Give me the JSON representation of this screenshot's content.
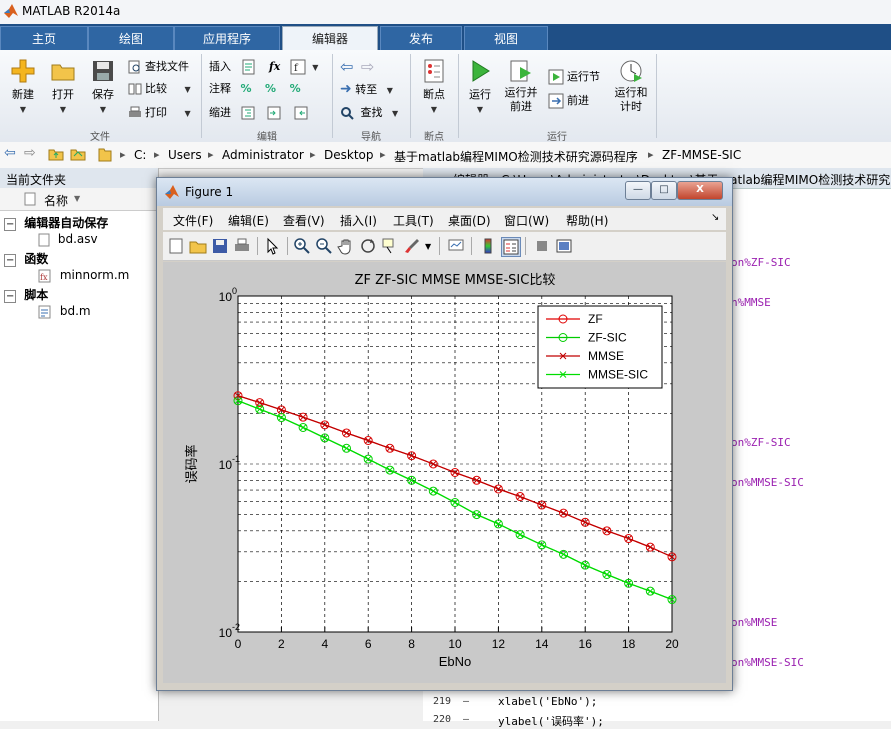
{
  "app": {
    "title": "MATLAB R2014a"
  },
  "tabs": [
    {
      "label": "主页"
    },
    {
      "label": "绘图"
    },
    {
      "label": "应用程序"
    },
    {
      "label": "编辑器",
      "active": true
    },
    {
      "label": "发布"
    },
    {
      "label": "视图"
    }
  ],
  "ribbon": {
    "file": {
      "new": "新建",
      "open": "打开",
      "save": "保存",
      "find_files": "查找文件",
      "compare": "比较",
      "print": "打印",
      "group": "文件"
    },
    "edit": {
      "insert": "插入",
      "comment": "注释",
      "indent": "缩进",
      "fx": "fx",
      "group": "编辑"
    },
    "nav": {
      "goto": "转至",
      "find": "查找",
      "group": "导航"
    },
    "breakpoints": {
      "label": "断点",
      "group": "断点"
    },
    "run": {
      "run": "运行",
      "run_advance": "运行并\n前进",
      "run_section": "运行节",
      "advance": "前进",
      "run_time": "运行和\n计时",
      "group": "运行"
    }
  },
  "path": [
    "C:",
    "Users",
    "Administrator",
    "Desktop",
    "基于matlab编程MIMO检测技术研究源码程序",
    "ZF-MMSE-SIC"
  ],
  "left_panel": {
    "title": "当前文件夹",
    "column": "名称",
    "tree": [
      {
        "label": "编辑器自动保存",
        "type": "folder"
      },
      {
        "label": "bd.asv",
        "type": "file"
      },
      {
        "label": "函数",
        "type": "folder"
      },
      {
        "label": "minnorm.m",
        "type": "file"
      },
      {
        "label": "脚本",
        "type": "folder"
      },
      {
        "label": "bd.m",
        "type": "file"
      }
    ]
  },
  "editor": {
    "header": "编辑器 - C:\\Users\\Administrator\\Desktop\\基于matlab编程MIMO检测技术研究",
    "snippets": [
      "on%ZF-SIC",
      "n%MMSE",
      "on%ZF-SIC",
      "on%MMSE-SIC",
      "on%MMSE",
      "on%MMSE-SIC"
    ],
    "lines": [
      {
        "num": "219",
        "dash": "–",
        "code": "xlabel('EbNo');"
      },
      {
        "num": "220",
        "dash": "–",
        "code": "ylabel('误码率');"
      }
    ]
  },
  "figure": {
    "title": "Figure 1",
    "menu": [
      "文件(F)",
      "编辑(E)",
      "查看(V)",
      "插入(I)",
      "工具(T)",
      "桌面(D)",
      "窗口(W)",
      "帮助(H)"
    ],
    "menu_arrow": "↘",
    "buttons": {
      "min": "—",
      "max": "□",
      "close": "X"
    }
  },
  "chart_data": {
    "type": "line",
    "title": "ZF ZF-SIC MMSE MMSE-SIC比较",
    "xlabel": "EbNo",
    "ylabel": "误码率",
    "xlim": [
      0,
      20
    ],
    "ylim": [
      0.01,
      1
    ],
    "yscale": "log",
    "grid": true,
    "legend_position": "top-right",
    "x_ticks": [
      0,
      2,
      4,
      6,
      8,
      10,
      12,
      14,
      16,
      18,
      20
    ],
    "x": [
      0,
      1,
      2,
      3,
      4,
      5,
      6,
      7,
      8,
      9,
      10,
      11,
      12,
      13,
      14,
      15,
      16,
      17,
      18,
      19,
      20
    ],
    "series": [
      {
        "name": "ZF",
        "color": "#e00000",
        "marker": "o",
        "values": [
          0.255,
          0.232,
          0.21,
          0.19,
          0.171,
          0.153,
          0.138,
          0.124,
          0.112,
          0.1,
          0.089,
          0.08,
          0.071,
          0.064,
          0.057,
          0.051,
          0.045,
          0.04,
          0.036,
          0.032,
          0.028
        ]
      },
      {
        "name": "ZF-SIC",
        "color": "#00cc00",
        "marker": "o",
        "values": [
          0.238,
          0.212,
          0.189,
          0.165,
          0.143,
          0.124,
          0.107,
          0.092,
          0.08,
          0.069,
          0.059,
          0.05,
          0.044,
          0.038,
          0.033,
          0.029,
          0.025,
          0.022,
          0.0195,
          0.0175,
          0.0156
        ]
      },
      {
        "name": "MMSE",
        "color": "#c00000",
        "marker": "x",
        "values": [
          0.255,
          0.232,
          0.21,
          0.19,
          0.171,
          0.153,
          0.138,
          0.124,
          0.112,
          0.1,
          0.089,
          0.08,
          0.071,
          0.064,
          0.057,
          0.051,
          0.045,
          0.04,
          0.036,
          0.032,
          0.028
        ]
      },
      {
        "name": "MMSE-SIC",
        "color": "#00dd00",
        "marker": "x",
        "values": [
          0.238,
          0.212,
          0.189,
          0.165,
          0.143,
          0.124,
          0.107,
          0.092,
          0.08,
          0.069,
          0.059,
          0.05,
          0.044,
          0.038,
          0.033,
          0.029,
          0.025,
          0.022,
          0.0195,
          0.0175,
          0.0156
        ]
      }
    ]
  }
}
